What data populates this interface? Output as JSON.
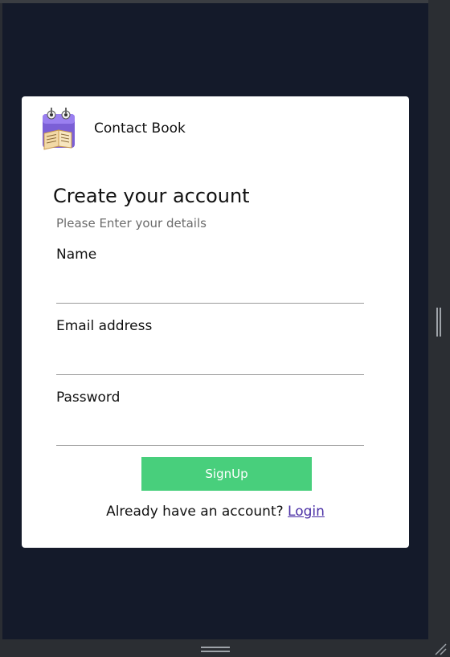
{
  "app": {
    "brand_name": "Contact Book"
  },
  "form": {
    "title": "Create your account",
    "subtitle": "Please Enter your details",
    "fields": [
      {
        "label": "Name",
        "value": "",
        "placeholder": ""
      },
      {
        "label": "Email address",
        "value": "",
        "placeholder": ""
      },
      {
        "label": "Password",
        "value": "",
        "placeholder": ""
      }
    ],
    "submit_label": "SignUp",
    "login_prompt": "Already have an account?",
    "login_link": "Login"
  },
  "colors": {
    "page_background": "#141a2a",
    "card_background": "#ffffff",
    "button": "#48cf7c",
    "link": "#4a2fa5"
  },
  "icons": {
    "logo": "calendar-book-logo"
  }
}
